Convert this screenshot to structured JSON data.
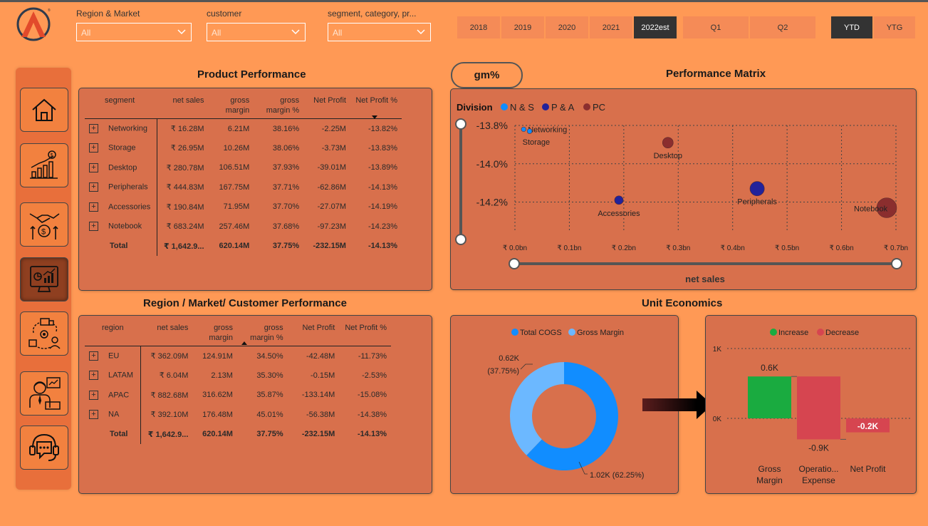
{
  "filters": [
    {
      "label": "Region & Market",
      "value": "All"
    },
    {
      "label": "customer",
      "value": "All"
    },
    {
      "label": "segment, category, pr...",
      "value": "All"
    }
  ],
  "years": [
    "2018",
    "2019",
    "2020",
    "2021",
    "2022est"
  ],
  "active_year": "2022est",
  "quarters": [
    "Q1",
    "Q2"
  ],
  "periods": [
    "YTD",
    "YTG"
  ],
  "active_period": "YTD",
  "sidebar": [
    {
      "icon": "home-icon"
    },
    {
      "icon": "sales-chart-icon"
    },
    {
      "icon": "finance-handshake-icon"
    },
    {
      "icon": "analytics-monitor-icon"
    },
    {
      "icon": "supply-chain-icon"
    },
    {
      "icon": "executive-icon"
    },
    {
      "icon": "support-chat-icon"
    }
  ],
  "product_performance": {
    "title": "Product Performance",
    "columns": [
      "segment",
      "net sales",
      "gross margin",
      "gross margin %",
      "Net Profit",
      "Net Profit %"
    ],
    "rows": [
      [
        "Networking",
        "₹ 16.28M",
        "6.21M",
        "38.16%",
        "-2.25M",
        "-13.82%"
      ],
      [
        "Storage",
        "₹ 26.95M",
        "10.26M",
        "38.06%",
        "-3.73M",
        "-13.83%"
      ],
      [
        "Desktop",
        "₹ 280.78M",
        "106.51M",
        "37.93%",
        "-39.01M",
        "-13.89%"
      ],
      [
        "Peripherals",
        "₹ 444.83M",
        "167.75M",
        "37.71%",
        "-62.86M",
        "-14.13%"
      ],
      [
        "Accessories",
        "₹ 190.84M",
        "71.95M",
        "37.70%",
        "-27.07M",
        "-14.19%"
      ],
      [
        "Notebook",
        "₹ 683.24M",
        "257.46M",
        "37.68%",
        "-97.23M",
        "-14.23%"
      ]
    ],
    "total": [
      "Total",
      "₹ 1,642.9...",
      "620.14M",
      "37.75%",
      "-232.15M",
      "-14.13%"
    ]
  },
  "region_performance": {
    "title": "Region / Market/ Customer Performance",
    "columns": [
      "region",
      "net sales",
      "gross margin",
      "gross margin %",
      "Net Profit",
      "Net Profit %"
    ],
    "rows": [
      [
        "EU",
        "₹ 362.09M",
        "124.91M",
        "34.50%",
        "-42.48M",
        "-11.73%"
      ],
      [
        "LATAM",
        "₹ 6.04M",
        "2.13M",
        "35.30%",
        "-0.15M",
        "-2.53%"
      ],
      [
        "APAC",
        "₹ 882.68M",
        "316.62M",
        "35.87%",
        "-133.14M",
        "-15.08%"
      ],
      [
        "NA",
        "₹ 392.10M",
        "176.48M",
        "45.01%",
        "-56.38M",
        "-14.38%"
      ]
    ],
    "total": [
      "Total",
      "₹ 1,642.9...",
      "620.14M",
      "37.75%",
      "-232.15M",
      "-14.13%"
    ]
  },
  "gm_button": "gm%",
  "chart_data": [
    {
      "type": "scatter",
      "title": "Performance Matrix",
      "legend_title": "Division",
      "legend_position": "top-left",
      "series": [
        {
          "name": "N & S",
          "color": "#118DFF"
        },
        {
          "name": "P & A",
          "color": "#22229A"
        },
        {
          "name": "PC",
          "color": "#8B2E2E"
        }
      ],
      "points": [
        {
          "label": "Networking",
          "division": "N & S",
          "x": 0.016,
          "y": -13.82
        },
        {
          "label": "Storage",
          "division": "N & S",
          "x": 0.027,
          "y": -13.83
        },
        {
          "label": "Desktop",
          "division": "PC",
          "x": 0.281,
          "y": -13.89
        },
        {
          "label": "Accessories",
          "division": "P & A",
          "x": 0.191,
          "y": -14.19
        },
        {
          "label": "Peripherals",
          "division": "P & A",
          "x": 0.445,
          "y": -14.13
        },
        {
          "label": "Notebook",
          "division": "PC",
          "x": 0.683,
          "y": -14.23
        }
      ],
      "xlabel": "net sales",
      "x_ticks": [
        "₹ 0.0bn",
        "₹ 0.1bn",
        "₹ 0.2bn",
        "₹ 0.3bn",
        "₹ 0.4bn",
        "₹ 0.5bn",
        "₹ 0.6bn",
        "₹ 0.7bn"
      ],
      "xlim": [
        0,
        0.7
      ],
      "y_ticks": [
        "-13.8%",
        "-14.0%",
        "-14.2%"
      ],
      "ylim": [
        -14.28,
        -13.8
      ],
      "grid": true
    },
    {
      "type": "pie",
      "title": "Unit Economics",
      "legend_position": "top",
      "slices": [
        {
          "name": "Total COGS",
          "value": 1.02,
          "label": "1.02K (62.25%)",
          "color": "#118DFF"
        },
        {
          "name": "Gross Margin",
          "value": 0.62,
          "label": "0.62K\n(37.75%)",
          "color": "#6CB8FF"
        }
      ]
    },
    {
      "type": "bar",
      "subtype": "waterfall",
      "legend": [
        {
          "name": "Increase",
          "color": "#1AAB40"
        },
        {
          "name": "Decrease",
          "color": "#D64550"
        }
      ],
      "legend_position": "top",
      "categories": [
        "Gross Margin",
        "Operatio... Expense",
        "Net Profit"
      ],
      "category_lines": [
        [
          "Gross",
          "Margin"
        ],
        [
          "Operatio...",
          "Expense"
        ],
        [
          "Net Profit"
        ]
      ],
      "values": [
        0.6,
        -0.9,
        -0.2
      ],
      "data_labels": [
        "0.6K",
        "-0.9K",
        "-0.2K"
      ],
      "y_ticks": [
        "1K",
        "0K"
      ],
      "ylim": [
        -0.3,
        1.0
      ],
      "grid": true
    }
  ]
}
